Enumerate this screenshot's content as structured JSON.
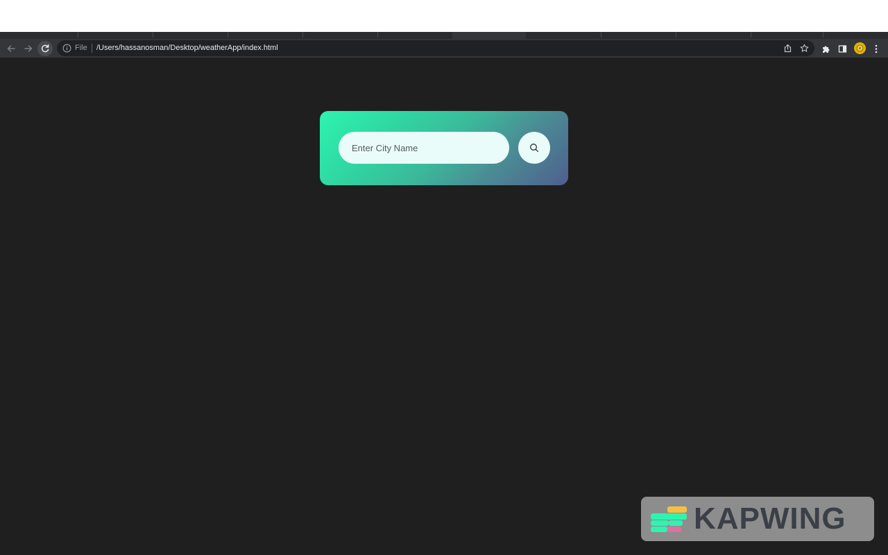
{
  "browser": {
    "omnibox": {
      "scheme_label": "File",
      "url": "/Users/hassanosman/Desktop/weatherApp/index.html"
    },
    "icons": {
      "back": "arrow-left-icon",
      "forward": "arrow-right-icon",
      "reload": "reload-icon",
      "site_info": "info-icon",
      "share": "share-icon",
      "bookmark": "star-icon",
      "extensions": "puzzle-icon",
      "side_panel": "side-panel-icon",
      "menu": "kebab-menu-icon"
    }
  },
  "weather_app": {
    "search": {
      "placeholder": "Enter City Name",
      "value": ""
    },
    "search_button_icon": "search-icon",
    "card_gradient": [
      "#2ef4b0",
      "#4f5f8e"
    ]
  },
  "watermark": {
    "text": "KAPWING",
    "logo_colors": [
      "#f4c042",
      "#2ef4b0",
      "#e0709e"
    ]
  },
  "colors": {
    "page_background": "#1f1f1f",
    "toolbar": "#35363a",
    "omnibox": "#202124"
  }
}
